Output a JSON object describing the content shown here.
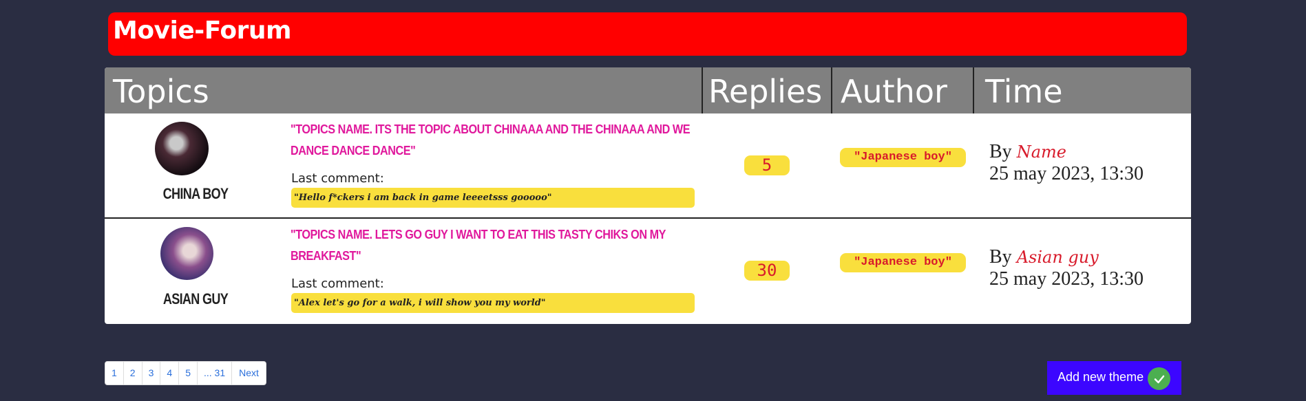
{
  "header": {
    "title": "Movie-Forum"
  },
  "table": {
    "columns": [
      "Topics",
      "Replies",
      "Author",
      "Time"
    ],
    "rows": [
      {
        "username": "CHINA BOY",
        "topic": "\"Topics name. its the topic about chinaaa and the chinaaa and we dance dance dance\"",
        "last_comment_label": "Last comment:",
        "last_comment": "\"Hello f*ckers i am back in game leeeetsss gooooo\"",
        "replies": "5",
        "author": "\"Japanese boy\"",
        "by": "By",
        "by_name": "Name",
        "time": "25 may 2023, 13:30"
      },
      {
        "username": "ASIAN GUY",
        "topic": "\"Topics name. lets go guy i want to eat this tasty chiks on my breakfast\"",
        "last_comment_label": "Last comment:",
        "last_comment": "\"Alex let's go for a walk, i will show you my world\"",
        "replies": "30",
        "author": "\"Japanese boy\"",
        "by": "By",
        "by_name": "Asian guy",
        "time": "25 may 2023, 13:30"
      }
    ]
  },
  "pagination": {
    "pages": [
      "1",
      "2",
      "3",
      "4",
      "5",
      "... 31"
    ],
    "next": "Next"
  },
  "add_button": {
    "label": "Add new theme"
  },
  "colors": {
    "background": "#2a2d42",
    "header": "#ff0000",
    "accent": "#f9df3d",
    "topic": "#e0189c",
    "button": "#3c06ff"
  }
}
